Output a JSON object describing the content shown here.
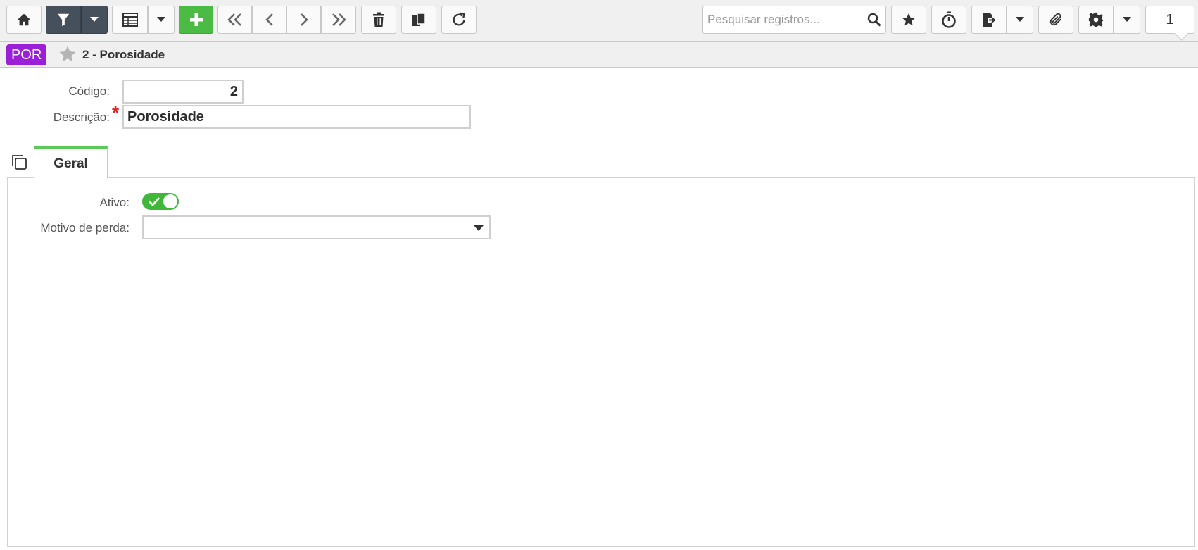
{
  "toolbar": {
    "icons": [
      "home-icon",
      "filter-icon",
      "caret-down-icon",
      "grid-icon",
      "plus-icon",
      "first-icon",
      "prev-icon",
      "next-icon",
      "last-icon",
      "trash-icon",
      "copy-icon",
      "refresh-icon",
      "star-icon",
      "timer-icon",
      "export-icon",
      "paperclip-icon",
      "gear-icon"
    ],
    "search_placeholder": "Pesquisar registros...",
    "page_number": "1",
    "colors": {
      "filter_bg": "#46505c",
      "add_bg": "#4cbb45"
    }
  },
  "breadcrumb": {
    "badge": "POR",
    "badge_color": "#9b1fd6",
    "title": "2 - Porosidade"
  },
  "form": {
    "codigo_label": "Código:",
    "codigo_value": "2",
    "descricao_label": "Descrição:",
    "descricao_value": "Porosidade",
    "required_mark": "*"
  },
  "tabs": [
    {
      "label": "Geral",
      "active": true
    }
  ],
  "general": {
    "ativo_label": "Ativo:",
    "ativo_on": true,
    "motivo_label": "Motivo de perda:",
    "motivo_value": ""
  }
}
